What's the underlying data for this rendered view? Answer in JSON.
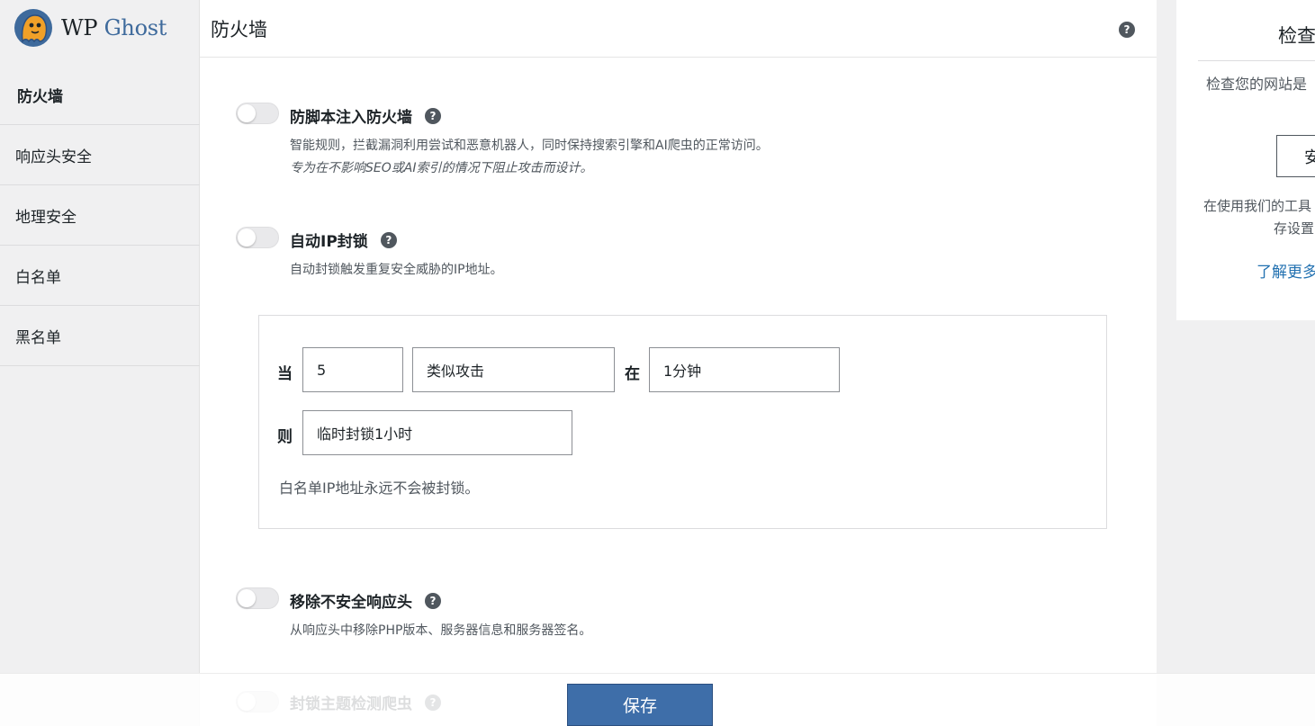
{
  "brand": {
    "name_prefix": "WP",
    "name_suffix": "Ghost"
  },
  "sidebar": {
    "items": [
      {
        "label": "防火墙",
        "active": true
      },
      {
        "label": "响应头安全"
      },
      {
        "label": "地理安全"
      },
      {
        "label": "白名单"
      },
      {
        "label": "黑名单"
      }
    ]
  },
  "header": {
    "title": "防火墙",
    "help": "?"
  },
  "options": [
    {
      "title": "防脚本注入防火墙",
      "enabled": false,
      "desc": "智能规则，拦截漏洞利用尝试和恶意机器人，同时保持搜索引擎和AI爬虫的正常访问。",
      "desc_italic": "专为在不影响SEO或AI索引的情况下阻止攻击而设计。"
    },
    {
      "title": "自动IP封锁",
      "enabled": false,
      "desc": "自动封锁触发重复安全威胁的IP地址。"
    },
    {
      "title": "移除不安全响应头",
      "enabled": false,
      "desc": "从响应头中移除PHP版本、服务器信息和服务器签名。"
    },
    {
      "title": "封锁主题检测爬虫",
      "enabled": false
    }
  ],
  "rule": {
    "when_label": "当",
    "count": "5",
    "type": "类似攻击",
    "in_label": "在",
    "period": "1分钟",
    "then_label": "则",
    "action": "临时封锁1小时",
    "note": "白名单IP地址永远不会被封锁。"
  },
  "footer": {
    "save_label": "保存"
  },
  "right_panel": {
    "title": "检查",
    "text1": "检查您的网站是",
    "button": "安",
    "text2": "在使用我们的工具",
    "text3": "存设置",
    "link": "了解更多"
  },
  "colors": {
    "primary_button": "#3e6ea9",
    "link": "#2271b1",
    "brand_blue": "#3e6a9c",
    "brand_orange": "#f0a028"
  }
}
